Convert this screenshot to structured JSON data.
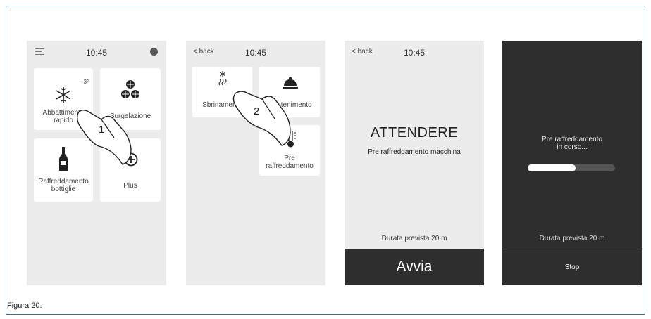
{
  "caption": "Figura 20.",
  "screen1": {
    "time": "10:45",
    "tiles": [
      {
        "label": "Abbattimento\nrapido",
        "icon": "snowflake-icon",
        "badge": "+3°"
      },
      {
        "label": "Surgelazione",
        "icon": "snowflakes-icon"
      },
      {
        "label": "Raffreddamento\nbottiglie",
        "icon": "bottle-icon"
      },
      {
        "label": "Plus",
        "icon": "plus-circle-icon"
      }
    ],
    "step": "1"
  },
  "screen2": {
    "back": "back",
    "time": "10:45",
    "tiles": [
      {
        "label": "Sbrinamento",
        "icon": "defrost-icon"
      },
      {
        "label": "Mantenimento",
        "icon": "cloche-icon"
      },
      {
        "label": "Pre\nraffreddamento",
        "icon": "thermometer-icon"
      }
    ],
    "step": "2"
  },
  "screen3": {
    "back": "back",
    "time": "10:45",
    "title": "ATTENDERE",
    "subtitle": "Pre raffreddamento macchina",
    "duration": "Durata prevista 20 m",
    "button": "Avvia"
  },
  "screen4": {
    "status": "Pre raffreddamento\nin corso...",
    "progress": 0.55,
    "duration": "Durata prevista 20 m",
    "button": "Stop"
  }
}
